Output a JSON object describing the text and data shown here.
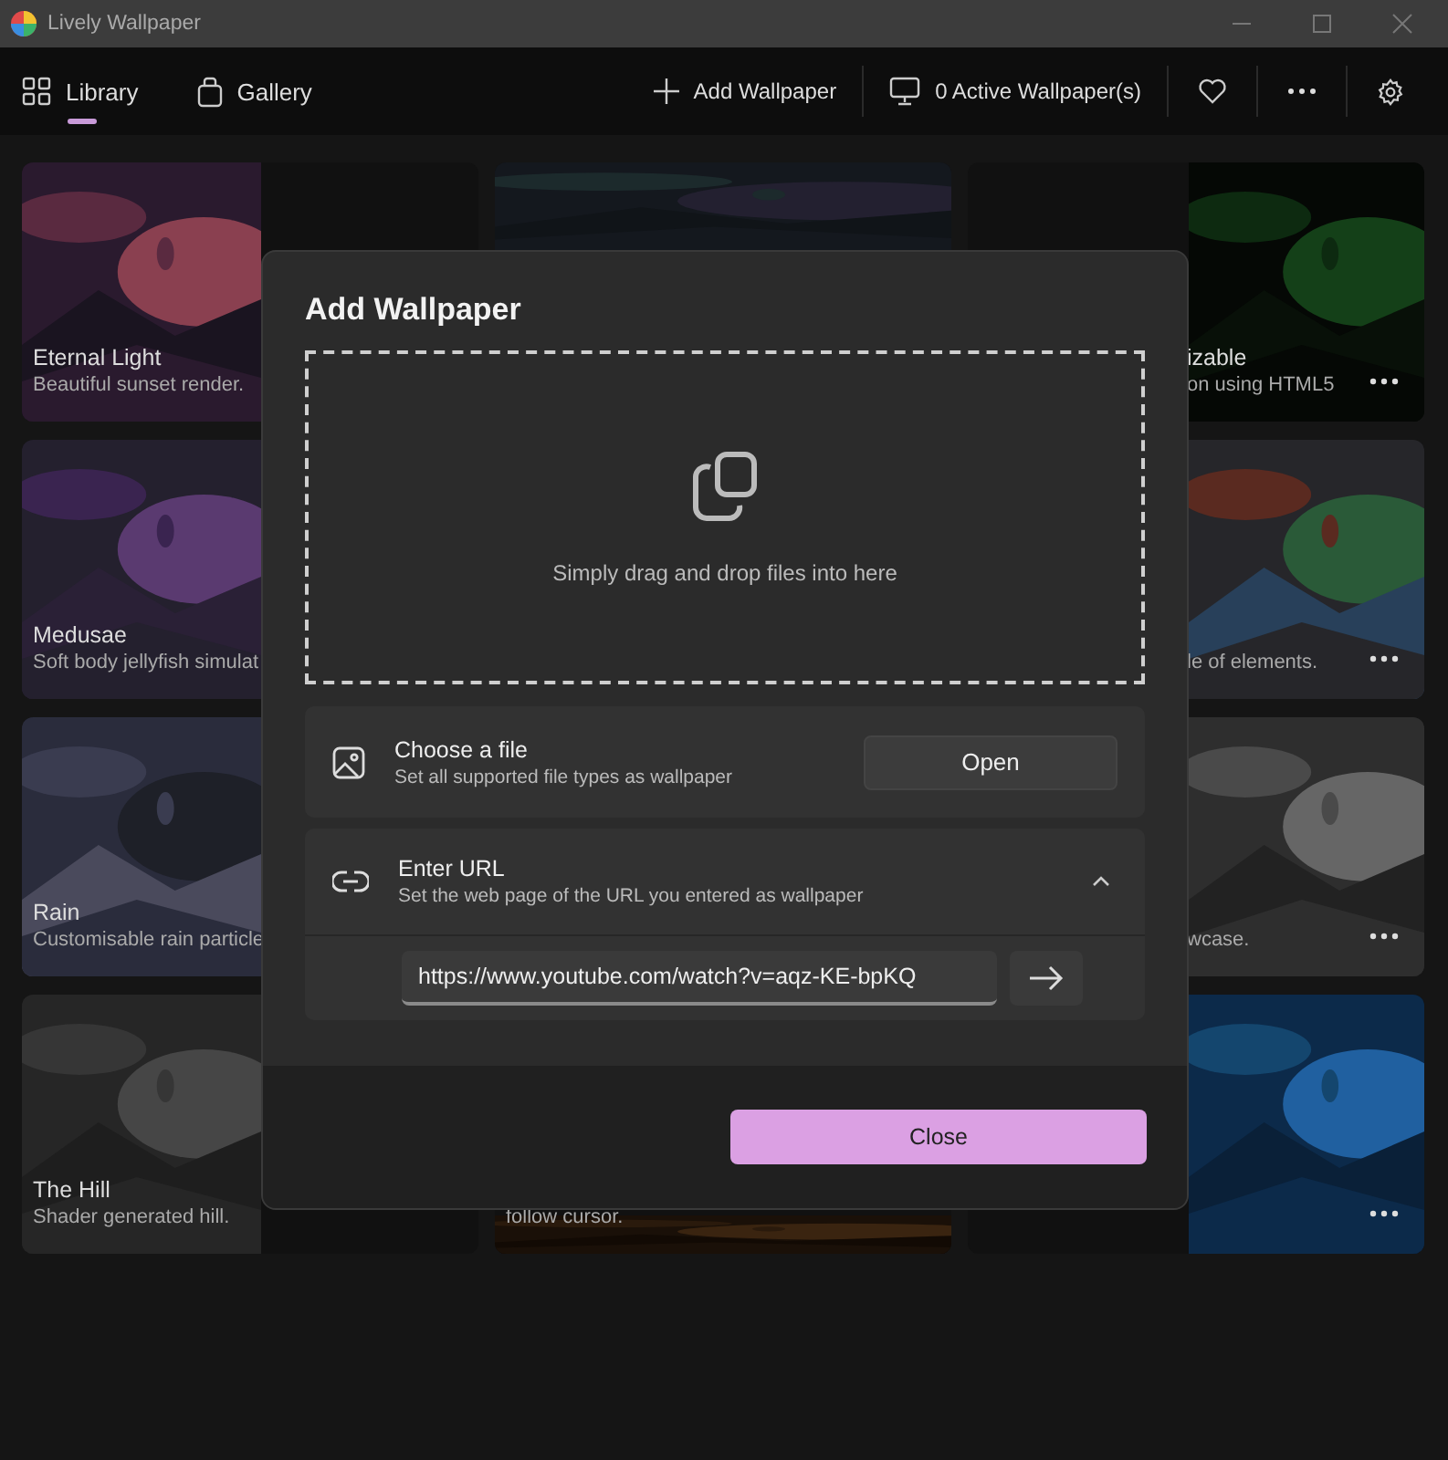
{
  "window": {
    "title": "Lively Wallpaper"
  },
  "tabs": [
    {
      "label": "Library",
      "selected": true
    },
    {
      "label": "Gallery",
      "selected": false
    }
  ],
  "actions": {
    "add": "Add Wallpaper",
    "active": "0 Active Wallpaper(s)"
  },
  "cards": [
    {
      "title": "Eternal Light",
      "description": "Beautiful sunset render.",
      "menu": false
    },
    {
      "menu": false
    },
    {
      "title": "izable",
      "description": "on using HTML5",
      "menu": true
    },
    {
      "title": "Medusae",
      "description": "Soft body jellyfish simulat",
      "menu": false
    },
    {
      "description": "le of elements.",
      "menu": true
    },
    {
      "title": "Rain",
      "description": "Customisable rain particle",
      "menu": false
    },
    {
      "description": "wcase.",
      "menu": true
    },
    {
      "title": "The Hill",
      "description": "Shader generated hill.",
      "menu": false
    },
    {
      "description": "follow cursor.",
      "menu": false
    },
    {
      "menu": true
    }
  ],
  "dialog": {
    "title": "Add Wallpaper",
    "drop_hint": "Simply drag and drop files into here",
    "choose_file": {
      "title": "Choose a file",
      "subtitle": "Set all supported file types as wallpaper",
      "button": "Open"
    },
    "enter_url": {
      "title": "Enter URL",
      "subtitle": "Set the web page of the URL you entered as wallpaper",
      "expanded": true,
      "value": "https://www.youtube.com/watch?v=aqz-KE-bpKQ"
    },
    "close": "Close"
  }
}
